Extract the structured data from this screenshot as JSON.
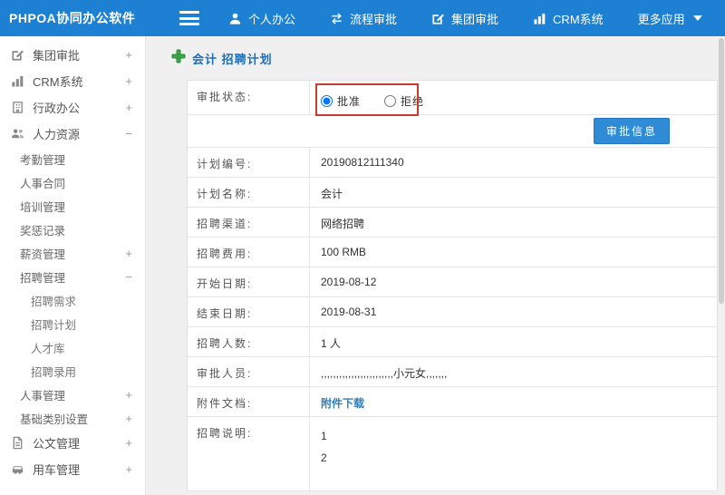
{
  "topbar": {
    "logo": "PHPOA协同办公软件",
    "nav": [
      {
        "label": "个人办公"
      },
      {
        "label": "流程审批"
      },
      {
        "label": "集团审批"
      },
      {
        "label": "CRM系统"
      },
      {
        "label": "更多应用"
      }
    ]
  },
  "sidebar": {
    "items": [
      {
        "label": "集团审批",
        "expand": "+"
      },
      {
        "label": "CRM系统",
        "expand": "+"
      },
      {
        "label": "行政办公",
        "expand": "+"
      },
      {
        "label": "人力资源",
        "expand": "−"
      },
      {
        "label": "考勤管理",
        "expand": ""
      },
      {
        "label": "人事合同",
        "expand": ""
      },
      {
        "label": "培训管理",
        "expand": ""
      },
      {
        "label": "奖惩记录",
        "expand": ""
      },
      {
        "label": "薪资管理",
        "expand": "+"
      },
      {
        "label": "招聘管理",
        "expand": "−"
      },
      {
        "label": "招聘需求",
        "expand": ""
      },
      {
        "label": "招聘计划",
        "expand": ""
      },
      {
        "label": "人才库",
        "expand": ""
      },
      {
        "label": "招聘录用",
        "expand": ""
      },
      {
        "label": "人事管理",
        "expand": "+"
      },
      {
        "label": "基础类别设置",
        "expand": "+"
      },
      {
        "label": "公文管理",
        "expand": "+"
      },
      {
        "label": "用车管理",
        "expand": "+"
      }
    ]
  },
  "main": {
    "breadcrumb": "会计 招聘计划",
    "approval": {
      "status_label": "审批状态:",
      "approve_label": "批准",
      "reject_label": "拒绝",
      "approve_checked": "checked",
      "info_button": "审批信息"
    },
    "rows": [
      {
        "label": "计划编号:",
        "value": "20190812111340"
      },
      {
        "label": "计划名称:",
        "value": "会计"
      },
      {
        "label": "招聘渠道:",
        "value": "网络招聘"
      },
      {
        "label": "招聘费用:",
        "value": "100 RMB"
      },
      {
        "label": "开始日期:",
        "value": "2019-08-12"
      },
      {
        "label": "结束日期:",
        "value": "2019-08-31"
      },
      {
        "label": "招聘人数:",
        "value": "1 人"
      },
      {
        "label": "审批人员:",
        "value": ",,,,,,,,,,,,,,,,,,,,,,,,小元女,,,,,,,"
      },
      {
        "label": "附件文档:",
        "value": "附件下载"
      },
      {
        "label": "招聘说明:",
        "line1": "1",
        "line2": "2"
      }
    ],
    "accent_color": "#1d80d2",
    "annotation_color": "#c53b32"
  }
}
